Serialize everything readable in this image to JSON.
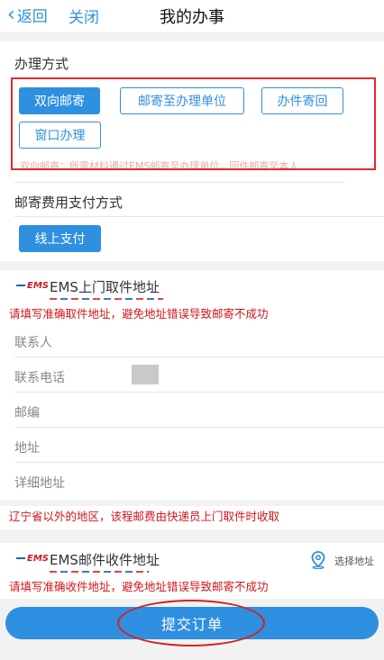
{
  "header": {
    "back_label": "返回",
    "close_label": "关闭",
    "title": "我的办事"
  },
  "handling": {
    "label": "办理方式",
    "options": [
      "双向邮寄",
      "邮寄至办理单位",
      "办件寄回",
      "窗口办理"
    ],
    "selected": "双向邮寄",
    "note": "双向邮寄：所需材料通过EMS邮寄至办理单位，回件邮寄至本人"
  },
  "payment": {
    "label": "邮寄费用支付方式",
    "option": "线上支付"
  },
  "pickup": {
    "logo": "EMS",
    "title": "EMS上门取件地址",
    "warning": "请填写准确取件地址，避免地址错误导致邮寄不成功",
    "fields": [
      "联系人",
      "联系电话",
      "邮编",
      "地址",
      "详细地址"
    ]
  },
  "region_notice": "辽宁省以外的地区，该程邮费由快递员上门取件时收取",
  "receive": {
    "logo": "EMS",
    "title": "EMS邮件收件地址",
    "select_label": "选择地址",
    "warning": "请填写准确收件地址，避免地址错误导致邮寄不成功"
  },
  "submit_label": "提交订单",
  "colors": {
    "accent": "#2f8fe0",
    "warning": "#d4141a",
    "annotation": "#e32b2b"
  }
}
